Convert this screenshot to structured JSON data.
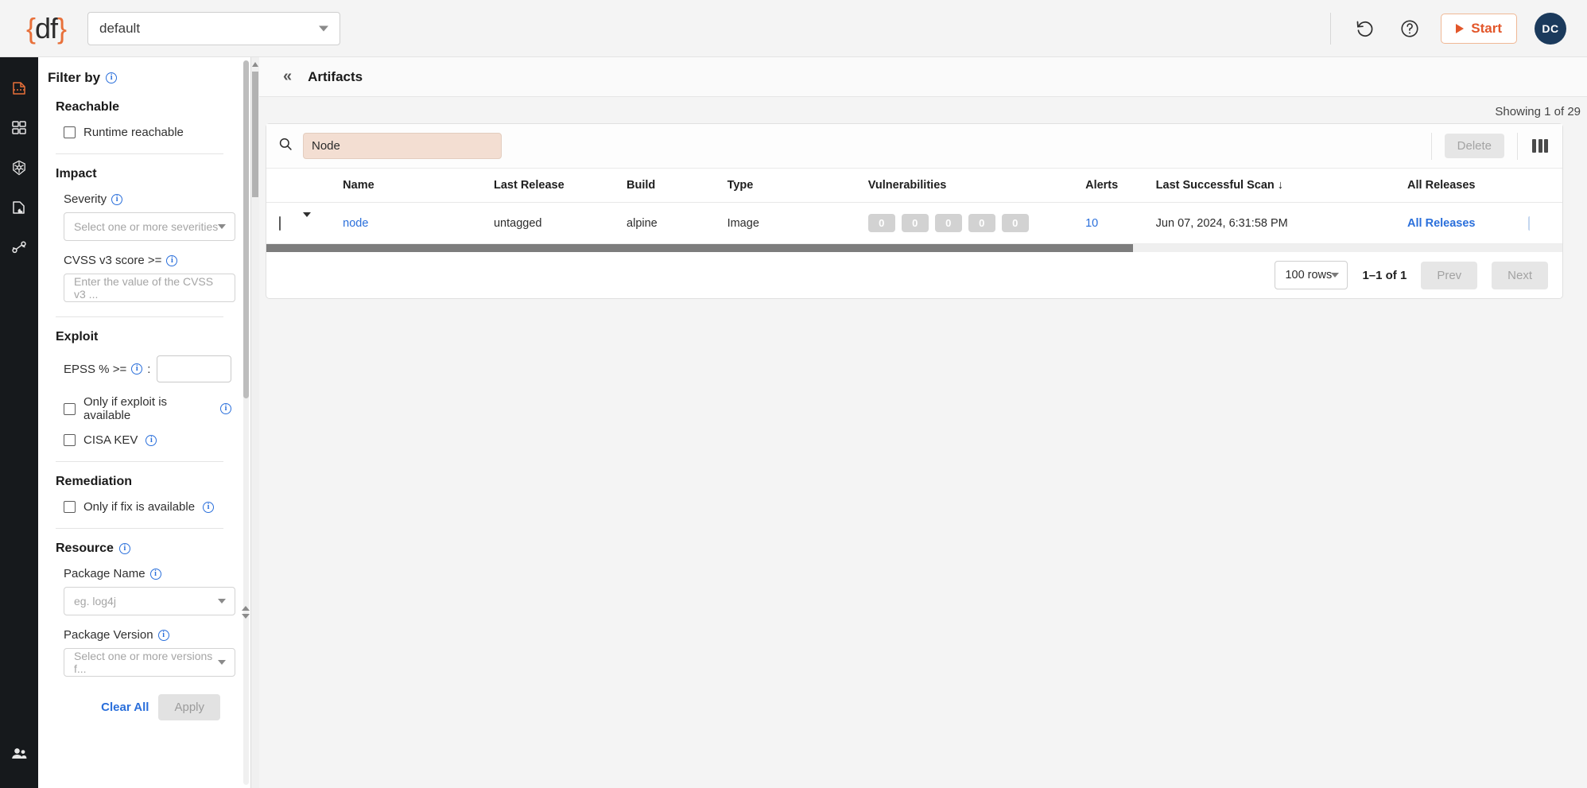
{
  "topbar": {
    "logo_text": "{df}",
    "namespace_value": "default",
    "refresh_icon": "refresh-icon",
    "help_icon": "help-circle-icon",
    "start_label": "Start",
    "avatar_initials": "DC"
  },
  "rail": {
    "items": [
      {
        "icon": "scan-document-icon",
        "active": true
      },
      {
        "icon": "grid-dashboard-icon",
        "active": false
      },
      {
        "icon": "kubernetes-icon",
        "active": false
      },
      {
        "icon": "registry-icon",
        "active": false
      },
      {
        "icon": "topology-icon",
        "active": false
      }
    ],
    "bottom": {
      "icon": "users-icon"
    }
  },
  "filters": {
    "title": "Filter by",
    "reachable": {
      "heading": "Reachable",
      "checkbox_label": "Runtime reachable"
    },
    "impact": {
      "heading": "Impact",
      "severity_label": "Severity",
      "severity_placeholder": "Select one or more severities",
      "cvss_label": "CVSS v3 score >=",
      "cvss_placeholder": "Enter the value of the CVSS v3 ..."
    },
    "exploit": {
      "heading": "Exploit",
      "epss_label": "EPSS % >=",
      "epss_suffix": ":",
      "epss_value": "",
      "exploit_available_label": "Only if exploit is available",
      "cisa_kev_label": "CISA KEV"
    },
    "remediation": {
      "heading": "Remediation",
      "fix_available_label": "Only if fix is available"
    },
    "resource": {
      "heading": "Resource",
      "package_name_label": "Package Name",
      "package_name_placeholder": "eg. log4j",
      "package_version_label": "Package Version",
      "package_version_placeholder": "Select one or more versions f..."
    },
    "clear_all_label": "Clear All",
    "apply_label": "Apply"
  },
  "main": {
    "collapse_icon": "chevron-double-left-icon",
    "title": "Artifacts",
    "showing_text": "Showing 1 of 29",
    "toolbar": {
      "search_icon": "search-icon",
      "search_value": "Node",
      "delete_label": "Delete",
      "columns_icon": "columns-icon"
    },
    "table": {
      "columns": [
        "Name",
        "Last Release",
        "Build",
        "Type",
        "Vulnerabilities",
        "Alerts",
        "Last Successful Scan",
        "All Releases"
      ],
      "sort_column": "Last Successful Scan",
      "sort_arrow": "↓",
      "rows": [
        {
          "name": "node",
          "last_release": "untagged",
          "build": "alpine",
          "type": "Image",
          "vulnerabilities": [
            "0",
            "0",
            "0",
            "0",
            "0"
          ],
          "alerts": "10",
          "last_successful_scan": "Jun 07, 2024, 6:31:58 PM",
          "all_releases": "All Releases"
        }
      ]
    },
    "pager": {
      "rows_per_page": "100 rows",
      "range": "1–1 of 1",
      "prev_label": "Prev",
      "next_label": "Next"
    }
  },
  "colors": {
    "accent_orange": "#e8703a",
    "link_blue": "#2a6fdb",
    "rail_dark": "#16191c",
    "search_highlight": "#f3ded2"
  }
}
